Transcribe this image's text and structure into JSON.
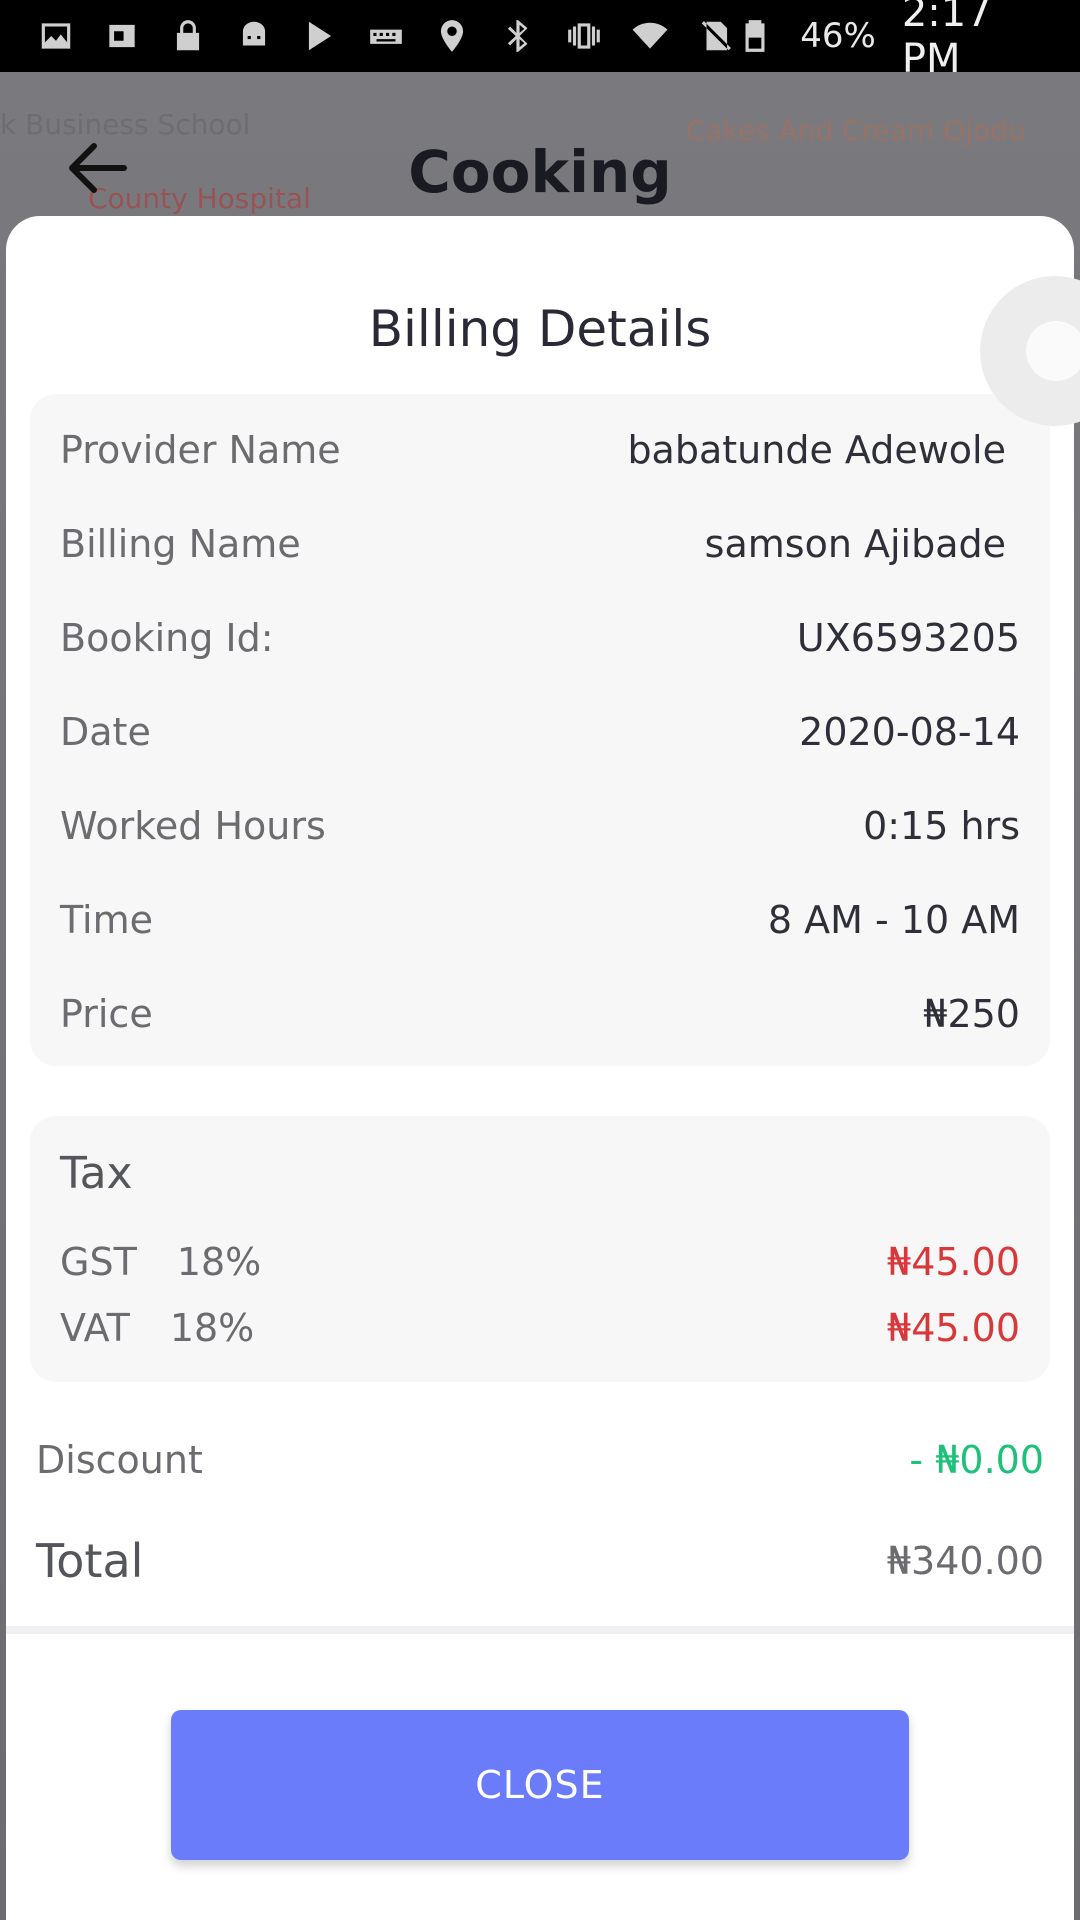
{
  "status_bar": {
    "battery_pct": "46%",
    "time": "2:17 PM",
    "icons": [
      "image-icon",
      "lens-icon",
      "lock-icon",
      "android-icon",
      "play-store-icon",
      "keyboard-icon",
      "location-icon",
      "bluetooth-icon",
      "vibrate-icon",
      "wifi-icon",
      "no-sim-icon",
      "battery-icon"
    ]
  },
  "map": {
    "labels": [
      "k Business School",
      "County Hospital",
      "Cakes And Cream Ojodu"
    ]
  },
  "header": {
    "title": "Cooking",
    "back_icon": "arrow-left-icon"
  },
  "sheet": {
    "title": "Billing Details",
    "details": [
      {
        "label": "Provider Name",
        "value": "babatunde Adewole"
      },
      {
        "label": "Billing Name",
        "value": "samson Ajibade"
      },
      {
        "label": "Booking Id:",
        "value": "UX6593205"
      },
      {
        "label": "Date",
        "value": "2020-08-14"
      },
      {
        "label": "Worked Hours",
        "value": "0:15 hrs"
      },
      {
        "label": "Time",
        "value": "8 AM - 10 AM"
      },
      {
        "label": "Price",
        "value": "₦250"
      }
    ],
    "tax": {
      "title": "Tax",
      "items": [
        {
          "name": "GST",
          "rate": "18%",
          "amount": "₦45.00"
        },
        {
          "name": "VAT",
          "rate": "18%",
          "amount": "₦45.00"
        }
      ]
    },
    "discount": {
      "label": "Discount",
      "value": "- ₦0.00"
    },
    "total": {
      "label": "Total",
      "value": "₦340.00"
    },
    "close_label": "CLOSE"
  },
  "colors": {
    "accent": "#6b7cfb",
    "tax_red": "#d8383a",
    "discount_green": "#1ec07a"
  }
}
